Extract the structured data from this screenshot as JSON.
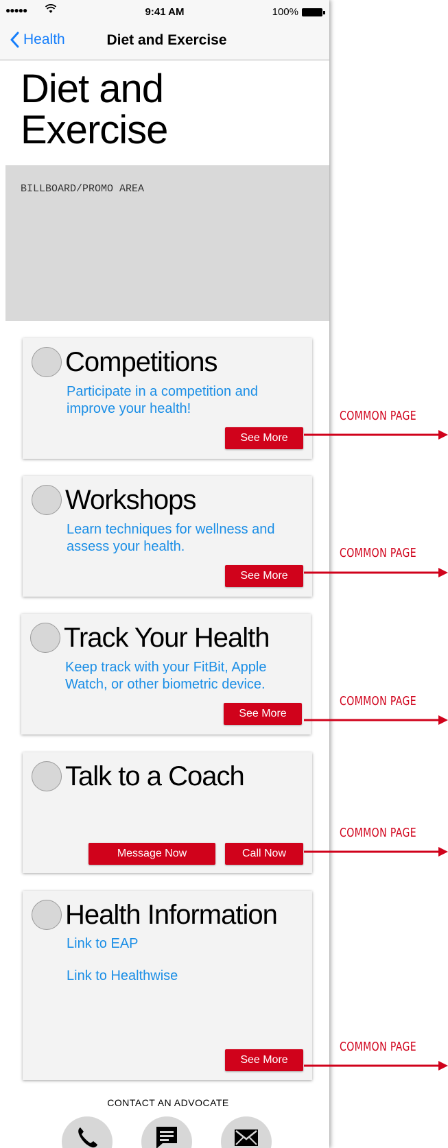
{
  "status_bar": {
    "signal": "●●●●●",
    "time": "9:41 AM",
    "battery_pct": "100%"
  },
  "navbar": {
    "back_label": "Health",
    "title": "Diet and Exercise"
  },
  "page": {
    "title_line1": "Diet and",
    "title_line2": "Exercise",
    "billboard_label": "BILLBOARD/PROMO AREA"
  },
  "cards": {
    "competitions": {
      "title": "Competitions",
      "description": "Participate in a competition and improve your health!",
      "button": "See More"
    },
    "workshops": {
      "title": "Workshops",
      "description": "Learn techniques for wellness and assess your health.",
      "button": "See More"
    },
    "track_health": {
      "title": "Track Your Health",
      "description": "Keep track with your FitBit, Apple Watch, or other biometric device.",
      "button": "See More"
    },
    "coach": {
      "title": "Talk to a Coach",
      "message_button": "Message Now",
      "call_button": "Call Now"
    },
    "health_info": {
      "title": "Health Information",
      "link1": "Link to EAP",
      "link2": "Link to Healthwise",
      "button": "See More"
    }
  },
  "contact": {
    "label": "CONTACT AN ADVOCATE",
    "icons": [
      "phone-icon",
      "message-icon",
      "mail-icon"
    ]
  },
  "annotations": {
    "a1": "COMMON PAGE",
    "a2": "COMMON PAGE",
    "a3": "COMMON PAGE",
    "a4": "COMMON PAGE",
    "a5": "COMMON PAGE"
  },
  "colors": {
    "accent_red": "#d0021b",
    "link_blue": "#1a8ee6",
    "ios_blue": "#157efb"
  }
}
